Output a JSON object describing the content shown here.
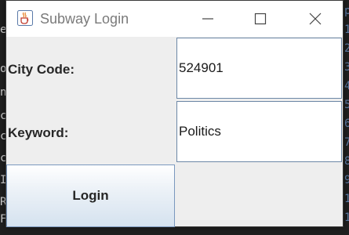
{
  "window": {
    "title": "Subway Login",
    "controls": {
      "minimize": "minimize-icon",
      "maximize": "maximize-icon",
      "close": "close-icon"
    }
  },
  "form": {
    "city_label": "City Code:",
    "city_value": "524901",
    "keyword_label": "Keyword:",
    "keyword_value": "Politics",
    "login_label": "Login"
  },
  "background": {
    "left_chars": [
      "e",
      "o",
      "n",
      "c",
      "c",
      "c",
      "IF",
      "R",
      "Fo",
      "ro"
    ],
    "right_chars": [
      "p",
      "1",
      "2",
      "3",
      "4",
      "5",
      "6",
      "7",
      "8",
      "9",
      "10",
      "11"
    ]
  },
  "colors": {
    "field_border": "#6c87a6",
    "button_gradient_bottom": "#d5e2ef",
    "window_bg": "#eeeeee"
  }
}
